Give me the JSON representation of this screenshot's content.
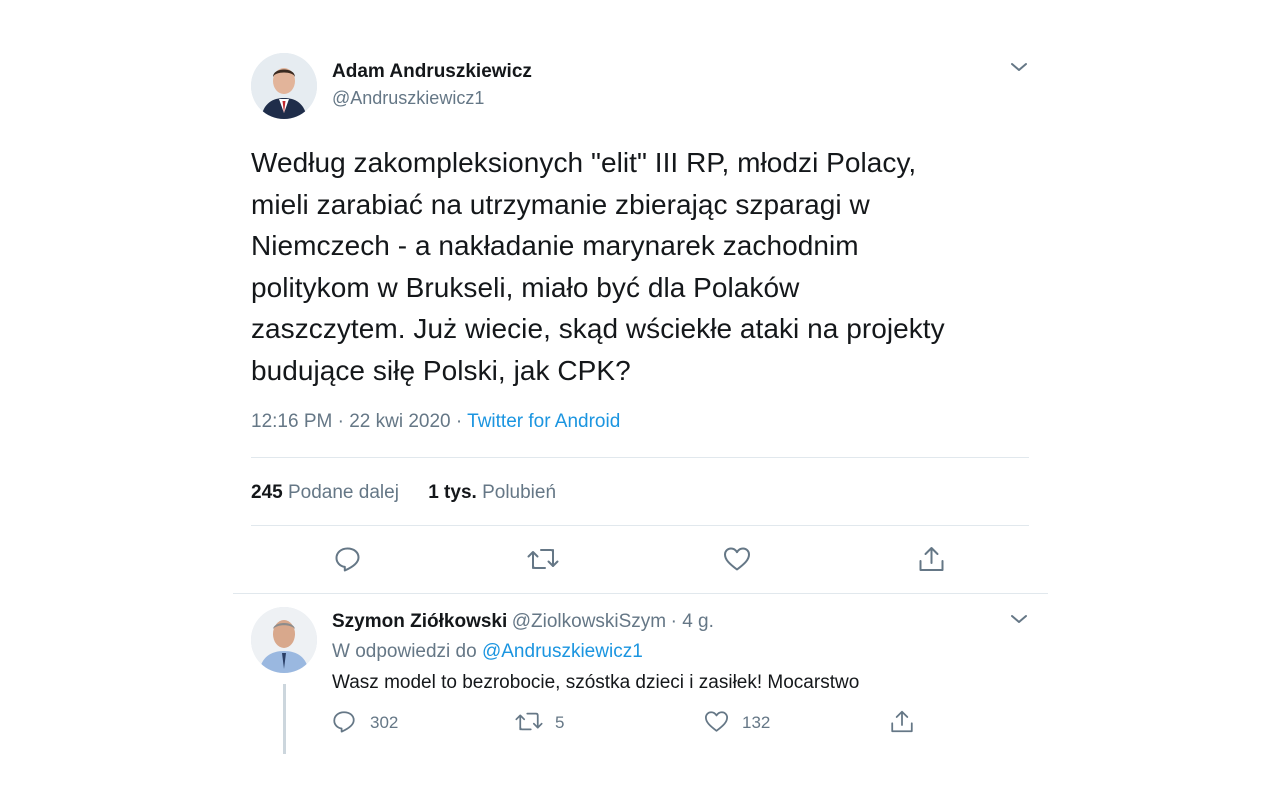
{
  "tweet": {
    "author_name": "Adam Andruszkiewicz",
    "author_handle": "@Andruszkiewicz1",
    "text_lines": [
      "Według zakompleksionych \"elit\" III RP, młodzi Polacy,",
      "mieli zarabiać na utrzymanie zbierając szparagi w",
      "Niemczech - a nakładanie marynarek zachodnim",
      "politykom w Brukseli, miało być dla Polaków",
      "zaszczytem. Już wiecie, skąd wściekłe ataki na projekty",
      "budujące siłę Polski, jak CPK?"
    ],
    "time": "12:16 PM · 22 kwi 2020 · ",
    "source": "Twitter for Android",
    "retweets_count": "245",
    "retweets_label": "Podane dalej",
    "likes_count": "1 tys.",
    "likes_label": "Polubień"
  },
  "reply": {
    "author_name": "Szymon Ziółkowski",
    "author_handle": "@ZiolkowskiSzym",
    "time_ago": "· 4 g.",
    "reply_to_prefix": "W odpowiedzi do ",
    "reply_to_handle": "@Andruszkiewicz1",
    "text": "Wasz model to bezrobocie, szóstka dzieci i zasiłek! Mocarstwo",
    "reply_count": "302",
    "retweet_count": "5",
    "like_count": "132"
  },
  "colors": {
    "accent": "#1b95e0",
    "muted": "#657786",
    "text": "#14171a",
    "divider": "#e1e8ed"
  },
  "icons": {
    "more": "chevron-down-icon",
    "reply": "reply-icon",
    "retweet": "retweet-icon",
    "like": "heart-icon",
    "share": "share-icon"
  }
}
